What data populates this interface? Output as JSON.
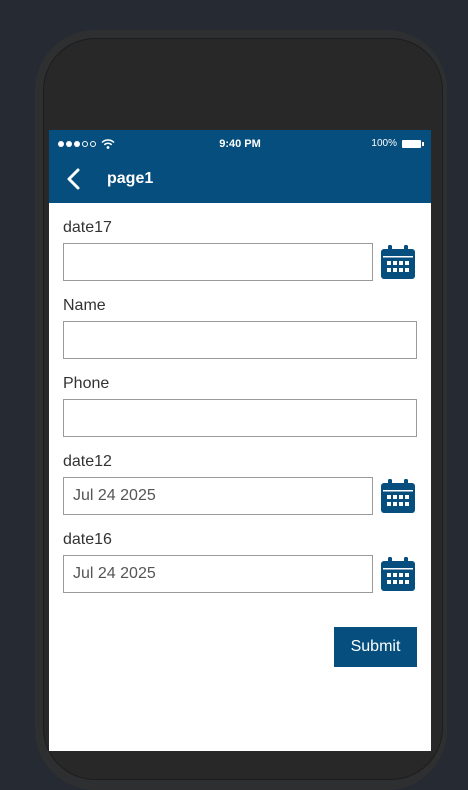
{
  "status": {
    "time": "9:40 PM",
    "battery": "100%"
  },
  "header": {
    "title": "page1"
  },
  "form": {
    "date17": {
      "label": "date17",
      "value": ""
    },
    "name": {
      "label": "Name",
      "value": ""
    },
    "phone": {
      "label": "Phone",
      "value": ""
    },
    "date12": {
      "label": "date12",
      "value": "Jul 24 2025"
    },
    "date16": {
      "label": "date16",
      "value": "Jul 24 2025"
    }
  },
  "actions": {
    "submit_label": "Submit"
  },
  "colors": {
    "primary": "#054e7e",
    "frame": "#2e2f30",
    "background": "#262b33"
  },
  "icons": [
    "back-chevron-icon",
    "calendar-icon",
    "wifi-icon",
    "battery-icon"
  ]
}
